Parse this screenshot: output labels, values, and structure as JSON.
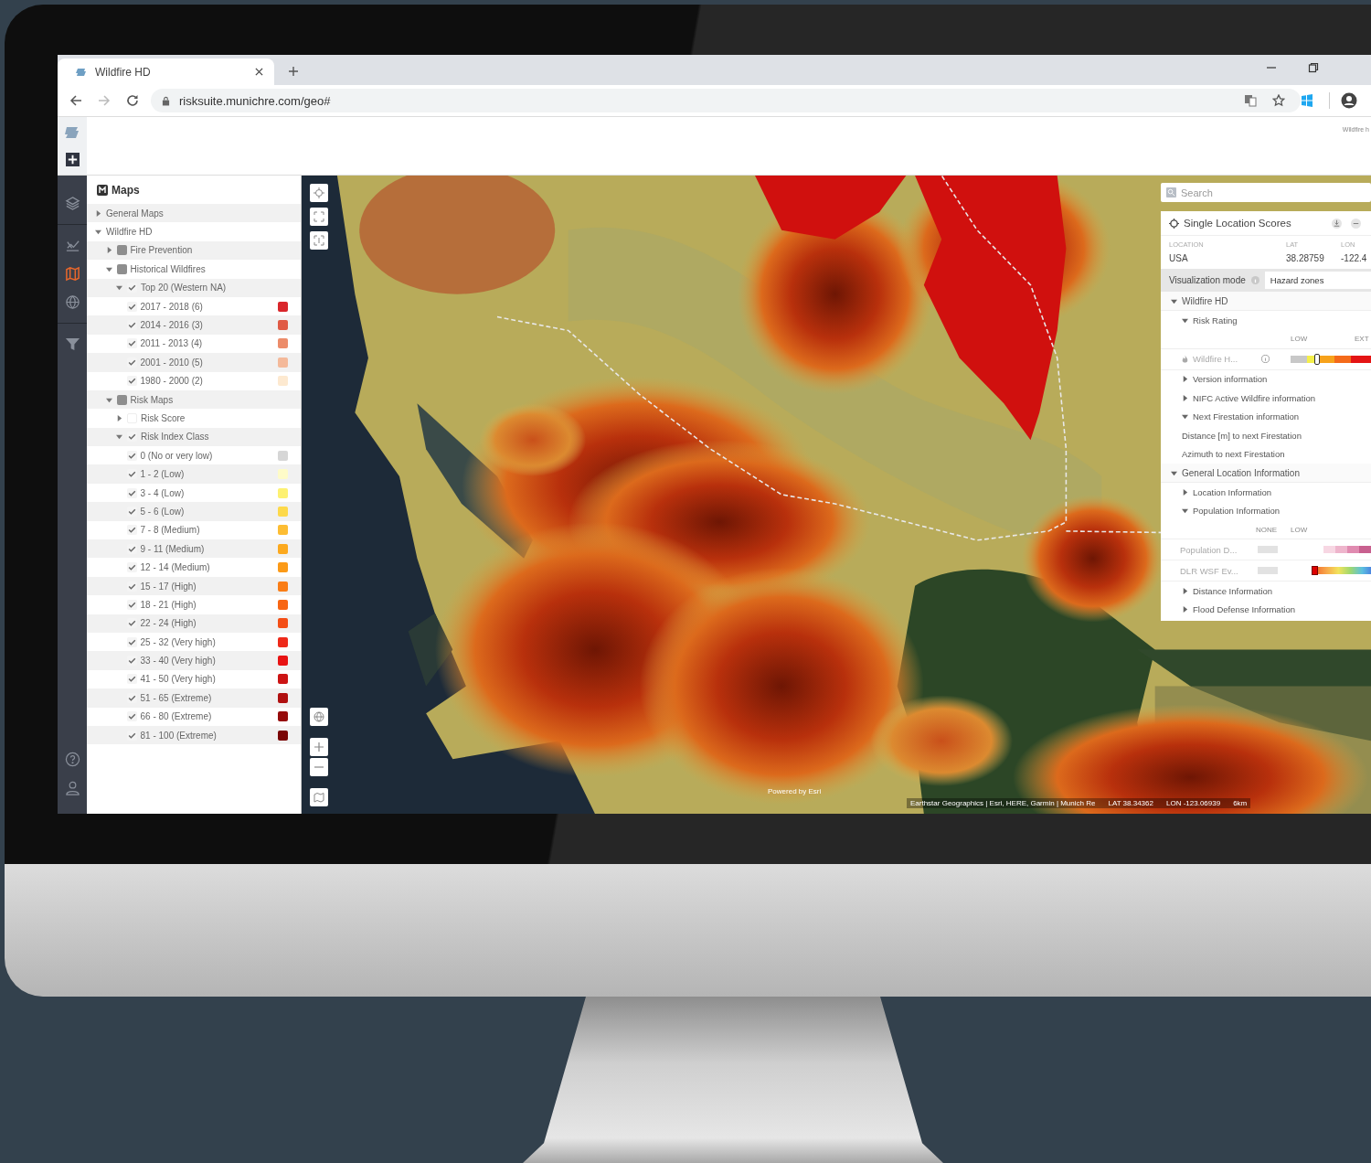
{
  "browser": {
    "tab": {
      "title": "Wildfire HD"
    },
    "url": "risksuite.munichre.com/geo#"
  },
  "header": {
    "note": "Wildfire h"
  },
  "rail": {
    "top": [
      {
        "kind": "layers",
        "selected": false
      },
      {
        "kind": "chart",
        "selected": false
      },
      {
        "kind": "map",
        "selected": true
      },
      {
        "kind": "globe",
        "selected": false
      },
      {
        "kind": "filter",
        "selected": false
      }
    ],
    "bottom": [
      {
        "kind": "help"
      },
      {
        "kind": "user"
      }
    ]
  },
  "layers": {
    "title": "Maps",
    "items": [
      {
        "label": "General Maps",
        "expanded": false
      },
      {
        "label": "Wildfire HD",
        "expanded": true,
        "children": [
          {
            "label": "Fire Prevention",
            "expanded": false,
            "checked": false,
            "indeterminate": true
          },
          {
            "label": "Historical Wildfires",
            "expanded": true,
            "checked": false,
            "indeterminate": true,
            "children": [
              {
                "label": "Top 20 (Western NA)",
                "expanded": true,
                "checked": true,
                "children": [
                  {
                    "label": "2017 - 2018 (6)",
                    "checked": true,
                    "color": "#d9262b"
                  },
                  {
                    "label": "2014 - 2016 (3)",
                    "checked": true,
                    "color": "#e05a45"
                  },
                  {
                    "label": "2011 - 2013 (4)",
                    "checked": true,
                    "color": "#ec8c6a"
                  },
                  {
                    "label": "2001 - 2010 (5)",
                    "checked": true,
                    "color": "#f4b99a"
                  },
                  {
                    "label": "1980 - 2000 (2)",
                    "checked": true,
                    "color": "#fde9d0"
                  }
                ]
              }
            ]
          },
          {
            "label": "Risk Maps",
            "expanded": true,
            "checked": false,
            "indeterminate": true,
            "children": [
              {
                "label": "Risk Score",
                "expanded": false,
                "checked": false
              },
              {
                "label": "Risk Index Class",
                "expanded": true,
                "checked": true,
                "children": [
                  {
                    "label": "0 (No or very low)",
                    "checked": true,
                    "color": "#d6d6d6"
                  },
                  {
                    "label": "1 - 2 (Low)",
                    "checked": true,
                    "color": "#fefbc8"
                  },
                  {
                    "label": "3 - 4 (Low)",
                    "checked": true,
                    "color": "#fdf172"
                  },
                  {
                    "label": "5 - 6 (Low)",
                    "checked": true,
                    "color": "#fdd94a"
                  },
                  {
                    "label": "7 - 8 (Medium)",
                    "checked": true,
                    "color": "#fdbd33"
                  },
                  {
                    "label": "9 - 11 (Medium)",
                    "checked": true,
                    "color": "#fca91e"
                  },
                  {
                    "label": "12 - 14 (Medium)",
                    "checked": true,
                    "color": "#fb9a18"
                  },
                  {
                    "label": "15 - 17 (High)",
                    "checked": true,
                    "color": "#fa7d16"
                  },
                  {
                    "label": "18 - 21 (High)",
                    "checked": true,
                    "color": "#f86614"
                  },
                  {
                    "label": "22 - 24 (High)",
                    "checked": true,
                    "color": "#f44e16"
                  },
                  {
                    "label": "25 - 32 (Very high)",
                    "checked": true,
                    "color": "#ee2a1a"
                  },
                  {
                    "label": "33 - 40 (Very high)",
                    "checked": true,
                    "color": "#e81313"
                  },
                  {
                    "label": "41 - 50 (Very high)",
                    "checked": true,
                    "color": "#cc1414"
                  },
                  {
                    "label": "51 - 65 (Extreme)",
                    "checked": true,
                    "color": "#b01010"
                  },
                  {
                    "label": "66 - 80 (Extreme)",
                    "checked": true,
                    "color": "#960c0c"
                  },
                  {
                    "label": "81 - 100 (Extreme)",
                    "checked": true,
                    "color": "#7a0606"
                  }
                ]
              }
            ]
          }
        ]
      }
    ]
  },
  "map": {
    "search": {
      "placeholder": "Search"
    },
    "attribution": {
      "powered": "Powered by Esri",
      "sources": "Earthstar Geographics | Esri, HERE, Garmin | Munich Re",
      "lat": "LAT 38.34362",
      "lon": "LON -123.06939",
      "scale": "6km"
    },
    "score_panel": {
      "title": "Single Location Scores",
      "location": {
        "labels": [
          "LOCATION",
          "LAT",
          "LON"
        ],
        "values": [
          "USA",
          "38.28759",
          "-122.4"
        ]
      },
      "mode": {
        "label": "Visualization mode",
        "value": "Hazard zones"
      },
      "sections": [
        {
          "title": "Wildfire HD",
          "expanded": true,
          "items": [
            {
              "kind": "group",
              "label": "Risk Rating",
              "expanded": true
            },
            {
              "kind": "scale",
              "labels": [
                "LOW",
                "EXT"
              ]
            },
            {
              "kind": "rating",
              "label": "Wildfire H...",
              "level": 0.3
            },
            {
              "kind": "group",
              "label": "Version information",
              "expanded": false
            },
            {
              "kind": "group",
              "label": "NIFC Active Wildfire information",
              "expanded": false
            },
            {
              "kind": "group",
              "label": "Next Firestation information",
              "expanded": true
            },
            {
              "kind": "text",
              "label": "Distance [m] to next Firestation"
            },
            {
              "kind": "text",
              "label": "Azimuth to next Firestation"
            }
          ]
        },
        {
          "title": "General Location Information",
          "expanded": true,
          "items": [
            {
              "kind": "group",
              "label": "Location Information",
              "expanded": false
            },
            {
              "kind": "group",
              "label": "Population Information",
              "expanded": true
            },
            {
              "kind": "scale",
              "labels": [
                "NONE",
                "LOW"
              ]
            },
            {
              "kind": "density",
              "label": "Population D..."
            },
            {
              "kind": "spectrum",
              "label": "DLR WSF Ev...",
              "level": 0
            },
            {
              "kind": "group",
              "label": "Distance Information",
              "expanded": false
            },
            {
              "kind": "group",
              "label": "Flood Defense Information",
              "expanded": false
            }
          ]
        }
      ]
    }
  }
}
